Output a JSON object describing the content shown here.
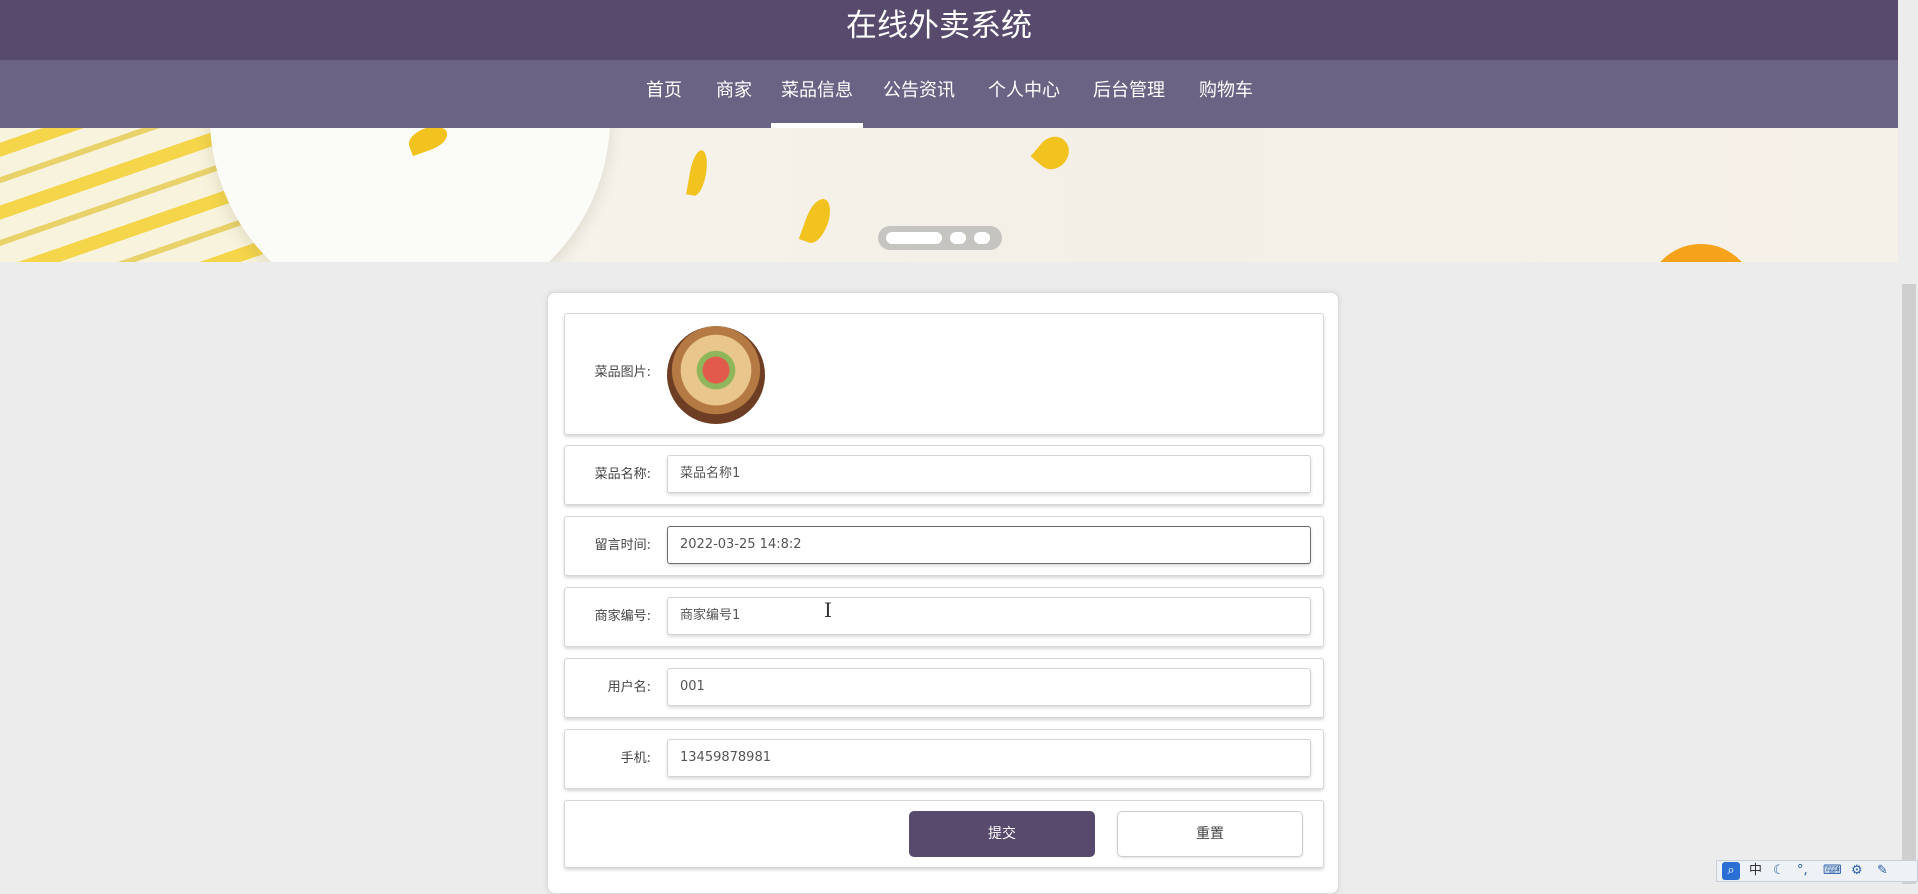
{
  "header": {
    "title": "在线外卖系统"
  },
  "nav": {
    "items": [
      {
        "label": "首页"
      },
      {
        "label": "商家"
      },
      {
        "label": "菜品信息",
        "active": true
      },
      {
        "label": "公告资讯"
      },
      {
        "label": "个人中心"
      },
      {
        "label": "后台管理"
      },
      {
        "label": "购物车"
      }
    ]
  },
  "carousel": {
    "slide_count": 3,
    "active_slide": 1
  },
  "form": {
    "image_label": "菜品图片:",
    "fields": [
      {
        "label": "菜品名称:",
        "value": "菜品名称1"
      },
      {
        "label": "留言时间:",
        "value": "2022-03-25 14:8:2"
      },
      {
        "label": "商家编号:",
        "value": "商家编号1"
      },
      {
        "label": "用户名:",
        "value": "001"
      },
      {
        "label": "手机:",
        "value": "13459878981"
      }
    ],
    "submit_label": "提交",
    "reset_label": "重置"
  },
  "tray": {
    "search_icon": "search-icon",
    "ime_mode": "中",
    "icons": [
      "moon-icon",
      "punctuation-icon",
      "keyboard-icon",
      "settings-icon",
      "wrench-icon"
    ]
  },
  "colors": {
    "header": "#574a6d",
    "nav": "#6b6384",
    "accent": "#574a6d"
  }
}
